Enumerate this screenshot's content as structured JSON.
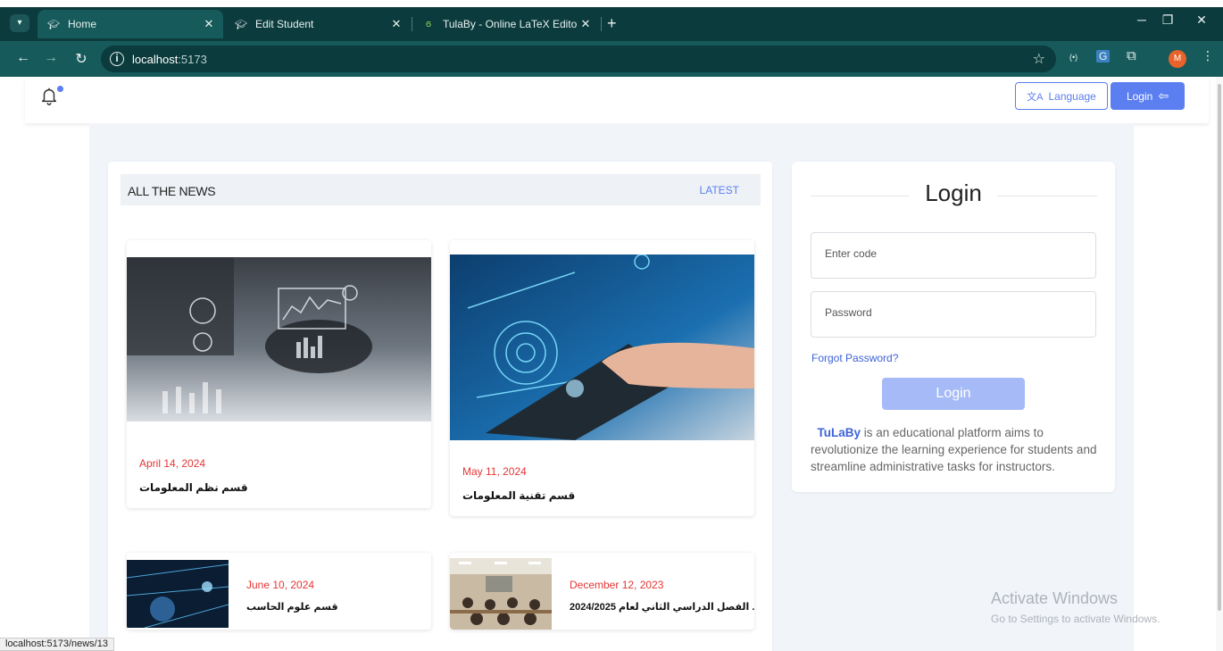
{
  "browser": {
    "tabs": [
      {
        "label": "Home",
        "active": true
      },
      {
        "label": "Edit Student",
        "active": false
      },
      {
        "label": "TulaBy - Online LaTeX Editor O...",
        "active": false
      }
    ],
    "url_host": "localhost",
    "url_port": ":5173",
    "profile_initial": "M"
  },
  "header": {
    "language_label": "Language",
    "login_label": "Login"
  },
  "news": {
    "heading": "ALL THE NEWS",
    "latest_label": "LATEST",
    "articles": [
      {
        "date": "April 14, 2024",
        "title": "قسم نظم المعلومات"
      },
      {
        "date": "May 11, 2024",
        "title": "قسم تقنية المعلومات"
      },
      {
        "date": "June 10, 2024",
        "title": "قسم علوم الحاسب"
      },
      {
        "date": "December 12, 2023",
        "title": "... الفصل الدراسي الثاني لعام 2024/2025"
      }
    ]
  },
  "login": {
    "title": "Login",
    "code_placeholder": "Enter code",
    "password_placeholder": "Password",
    "forgot_label": "Forgot Password?",
    "button_label": "Login",
    "brand": "TuLaBy",
    "description": " is an educational platform aims to revolutionize the learning experience for students and streamline administrative tasks for instructors."
  },
  "watermark": {
    "line1": "Activate Windows",
    "line2": "Go to Settings to activate Windows."
  },
  "status_url": "localhost:5173/news/13",
  "colors": {
    "accent": "#5b7ef0",
    "date_red": "#e53535",
    "chrome_dark": "#0b3b3c",
    "chrome_mid": "#175a5b"
  }
}
